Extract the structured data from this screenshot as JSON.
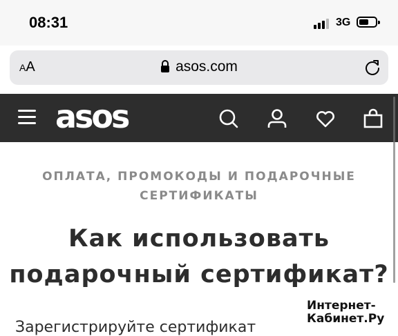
{
  "status_bar": {
    "time": "08:31",
    "network": "3G",
    "battery_level": 0.6
  },
  "browser": {
    "text_size_label_small": "A",
    "text_size_label_large": "A",
    "url": "asos.com",
    "icons": {
      "lock": "lock-icon",
      "reload": "reload-icon"
    }
  },
  "site_nav": {
    "logo": "asos",
    "background": "#2d2d2d",
    "icons": [
      "menu-icon",
      "search-icon",
      "account-icon",
      "heart-icon",
      "bag-icon"
    ]
  },
  "article": {
    "category": "ОПЛАТА, ПРОМОКОДЫ И ПОДАРОЧНЫЕ СЕРТИФИКАТЫ",
    "title": "Как использовать подарочный сертификат?",
    "first_step": "Зарегистрируйте сертификат"
  },
  "watermark": {
    "line1": "Интернет-",
    "line2": "Кабинет.Ру"
  }
}
